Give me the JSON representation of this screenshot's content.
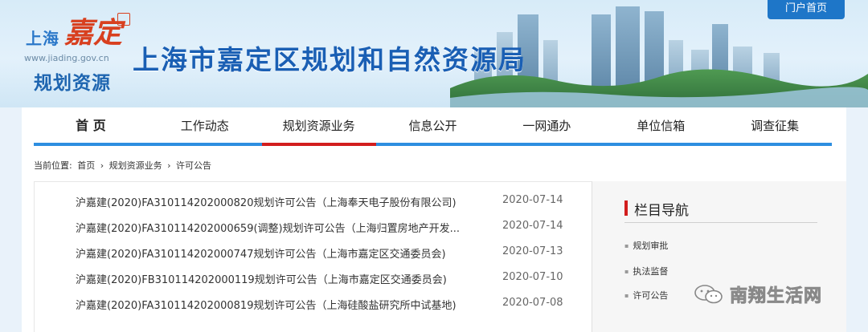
{
  "header": {
    "logo_text": "上海",
    "logo_mark": "嘉定",
    "logo_url": "www.jiading.gov.cn",
    "logo_subtitle": "规划资源",
    "site_title": "上海市嘉定区规划和自然资源局",
    "home_button": "门户首页"
  },
  "nav": [
    {
      "label": "首 页"
    },
    {
      "label": "工作动态"
    },
    {
      "label": "规划资源业务"
    },
    {
      "label": "信息公开"
    },
    {
      "label": "一网通办"
    },
    {
      "label": "单位信箱"
    },
    {
      "label": "调查征集"
    }
  ],
  "breadcrumb": {
    "prefix": "当前位置:",
    "items": [
      "首页",
      "›",
      "规划资源业务",
      "›",
      "许可公告"
    ]
  },
  "notices": [
    {
      "title": "沪嘉建(2020)FA310114202000820规划许可公告（上海奉天电子股份有限公司)",
      "date": "2020-07-14"
    },
    {
      "title": "沪嘉建(2020)FA310114202000659(调整)规划许可公告（上海归置房地产开发...",
      "date": "2020-07-14"
    },
    {
      "title": "沪嘉建(2020)FA310114202000747规划许可公告（上海市嘉定区交通委员会)",
      "date": "2020-07-13"
    },
    {
      "title": "沪嘉建(2020)FB310114202000119规划许可公告（上海市嘉定区交通委员会)",
      "date": "2020-07-10"
    },
    {
      "title": "沪嘉建(2020)FA310114202000819规划许可公告（上海硅酸盐研究所中试基地)",
      "date": "2020-07-08"
    }
  ],
  "sidebar": {
    "title": "栏目导航",
    "links": [
      "规划审批",
      "执法监督",
      "许可公告"
    ]
  },
  "watermark": {
    "text": "南翔生活网"
  },
  "colors": {
    "brand_blue": "#1a5fb4",
    "nav_underline": "#2d8ee0",
    "active_red": "#d21e1e"
  }
}
